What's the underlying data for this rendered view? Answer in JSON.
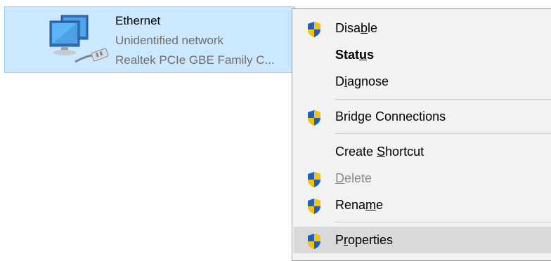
{
  "adapter": {
    "name": "Ethernet",
    "status": "Unidentified network",
    "device": "Realtek PCIe GBE Family C..."
  },
  "menu": {
    "items": [
      {
        "id": "disable",
        "pre": "Disa",
        "acc": "b",
        "post": "le",
        "shield": true,
        "bold": false,
        "disabled": false
      },
      {
        "id": "status",
        "pre": "Stat",
        "acc": "u",
        "post": "s",
        "shield": false,
        "bold": true,
        "disabled": false
      },
      {
        "id": "diagnose",
        "pre": "D",
        "acc": "i",
        "post": "agnose",
        "shield": false,
        "bold": false,
        "disabled": false
      },
      {
        "id": "bridge",
        "pre": "Brid",
        "acc": "g",
        "post": "e Connections",
        "shield": true,
        "bold": false,
        "disabled": false
      },
      {
        "id": "shortcut",
        "pre": "Create ",
        "acc": "S",
        "post": "hortcut",
        "shield": false,
        "bold": false,
        "disabled": false
      },
      {
        "id": "delete",
        "pre": "",
        "acc": "D",
        "post": "elete",
        "shield": true,
        "bold": false,
        "disabled": true
      },
      {
        "id": "rename",
        "pre": "Rena",
        "acc": "m",
        "post": "e",
        "shield": true,
        "bold": false,
        "disabled": false
      },
      {
        "id": "properties",
        "pre": "P",
        "acc": "r",
        "post": "operties",
        "shield": true,
        "bold": false,
        "disabled": false
      }
    ]
  },
  "colors": {
    "selection_bg": "#cce8ff",
    "selection_border": "#99d1ff",
    "menu_bg": "#f2f2f2",
    "hover_bg": "#d9d9d9",
    "shield_blue": "#1f5fbf",
    "shield_yellow": "#f5c400"
  },
  "icons": {
    "adapter": "network-adapter-icon",
    "uac": "uac-shield-icon"
  }
}
